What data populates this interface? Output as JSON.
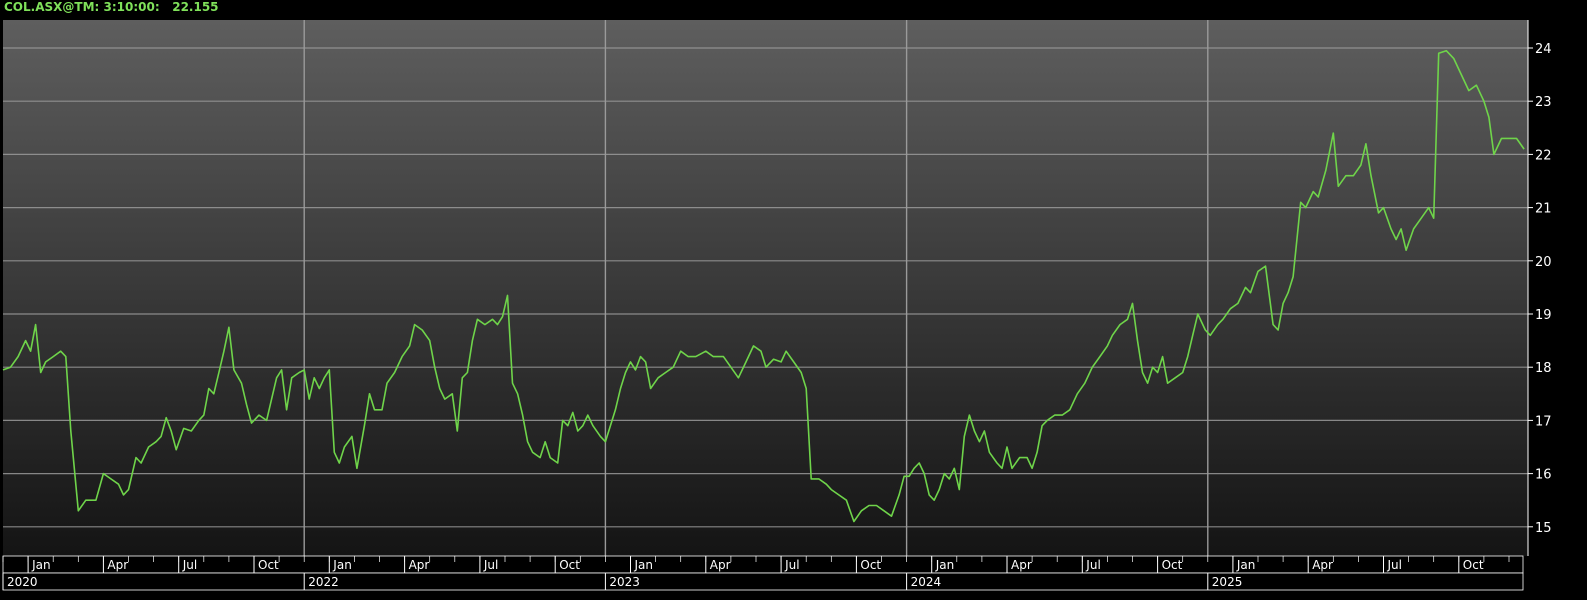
{
  "header": {
    "symbol": "COL.ASX@TM",
    "time": "3:10:00:",
    "last_price": "22.155"
  },
  "colors": {
    "line": "#6fd44a",
    "header_text": "#7fe05a",
    "grid": "#9a9a9a",
    "axis_text": "#ffffff",
    "background_top": "#5e5e5e",
    "background_bottom": "#141414"
  },
  "chart_data": {
    "type": "line",
    "title": "",
    "xlabel": "",
    "ylabel": "",
    "ylim": [
      14.6,
      24.6
    ],
    "yticks": [
      15,
      16,
      17,
      18,
      19,
      20,
      21,
      22,
      23,
      24
    ],
    "grid": true,
    "legend": "none",
    "month_labels": [
      {
        "m": 1,
        "label": "Jan"
      },
      {
        "m": 4,
        "label": "Apr"
      },
      {
        "m": 7,
        "label": "Jul"
      },
      {
        "m": 10,
        "label": "Oct"
      },
      {
        "m": 13,
        "label": "Jan"
      },
      {
        "m": 16,
        "label": "Apr"
      },
      {
        "m": 19,
        "label": "Jul"
      },
      {
        "m": 22,
        "label": "Oct"
      },
      {
        "m": 25,
        "label": "Jan"
      },
      {
        "m": 28,
        "label": "Apr"
      },
      {
        "m": 31,
        "label": "Jul"
      },
      {
        "m": 34,
        "label": "Oct"
      },
      {
        "m": 37,
        "label": "Jan"
      },
      {
        "m": 40,
        "label": "Apr"
      },
      {
        "m": 43,
        "label": "Jul"
      },
      {
        "m": 46,
        "label": "Oct"
      },
      {
        "m": 49,
        "label": "Jan"
      },
      {
        "m": 52,
        "label": "Apr"
      },
      {
        "m": 55,
        "label": "Jul"
      },
      {
        "m": 58,
        "label": "Oct"
      }
    ],
    "year_labels": [
      {
        "m": 0,
        "label": "2020"
      },
      {
        "m": 12,
        "label": "2022"
      },
      {
        "m": 24,
        "label": "2023"
      },
      {
        "m": 36,
        "label": "2024"
      },
      {
        "m": 48,
        "label": "2025"
      }
    ],
    "series": [
      {
        "values": [
          [
            0,
            17.95
          ],
          [
            0.3,
            18.0
          ],
          [
            0.6,
            18.2
          ],
          [
            0.9,
            18.5
          ],
          [
            1.1,
            18.3
          ],
          [
            1.3,
            18.8
          ],
          [
            1.5,
            17.9
          ],
          [
            1.7,
            18.1
          ],
          [
            2.0,
            18.2
          ],
          [
            2.3,
            18.3
          ],
          [
            2.5,
            18.2
          ],
          [
            2.7,
            16.8
          ],
          [
            3.0,
            15.3
          ],
          [
            3.3,
            15.5
          ],
          [
            3.7,
            15.5
          ],
          [
            4.0,
            16.0
          ],
          [
            4.3,
            15.9
          ],
          [
            4.6,
            15.8
          ],
          [
            4.8,
            15.6
          ],
          [
            5.0,
            15.7
          ],
          [
            5.3,
            16.3
          ],
          [
            5.5,
            16.2
          ],
          [
            5.8,
            16.5
          ],
          [
            6.1,
            16.6
          ],
          [
            6.3,
            16.7
          ],
          [
            6.5,
            17.05
          ],
          [
            6.7,
            16.8
          ],
          [
            6.9,
            16.45
          ],
          [
            7.2,
            16.85
          ],
          [
            7.5,
            16.8
          ],
          [
            7.8,
            17.0
          ],
          [
            8.0,
            17.1
          ],
          [
            8.2,
            17.6
          ],
          [
            8.4,
            17.5
          ],
          [
            8.6,
            17.9
          ],
          [
            8.8,
            18.3
          ],
          [
            9.0,
            18.75
          ],
          [
            9.2,
            17.95
          ],
          [
            9.5,
            17.7
          ],
          [
            9.7,
            17.3
          ],
          [
            9.9,
            16.95
          ],
          [
            10.2,
            17.1
          ],
          [
            10.5,
            17.0
          ],
          [
            10.7,
            17.4
          ],
          [
            10.9,
            17.8
          ],
          [
            11.1,
            17.95
          ],
          [
            11.3,
            17.2
          ],
          [
            11.5,
            17.8
          ],
          [
            11.8,
            17.9
          ],
          [
            12.0,
            17.95
          ],
          [
            12.2,
            17.4
          ],
          [
            12.4,
            17.8
          ],
          [
            12.6,
            17.6
          ],
          [
            12.8,
            17.8
          ],
          [
            13.0,
            17.95
          ],
          [
            13.2,
            16.4
          ],
          [
            13.4,
            16.2
          ],
          [
            13.6,
            16.5
          ],
          [
            13.9,
            16.7
          ],
          [
            14.1,
            16.1
          ],
          [
            14.4,
            16.9
          ],
          [
            14.6,
            17.5
          ],
          [
            14.8,
            17.2
          ],
          [
            15.1,
            17.2
          ],
          [
            15.3,
            17.7
          ],
          [
            15.6,
            17.9
          ],
          [
            15.9,
            18.2
          ],
          [
            16.2,
            18.4
          ],
          [
            16.4,
            18.8
          ],
          [
            16.7,
            18.7
          ],
          [
            17.0,
            18.5
          ],
          [
            17.2,
            18.0
          ],
          [
            17.4,
            17.6
          ],
          [
            17.6,
            17.4
          ],
          [
            17.9,
            17.5
          ],
          [
            18.1,
            16.8
          ],
          [
            18.3,
            17.8
          ],
          [
            18.5,
            17.9
          ],
          [
            18.7,
            18.5
          ],
          [
            18.9,
            18.9
          ],
          [
            19.2,
            18.8
          ],
          [
            19.5,
            18.9
          ],
          [
            19.7,
            18.8
          ],
          [
            19.9,
            18.95
          ],
          [
            20.1,
            19.35
          ],
          [
            20.3,
            17.7
          ],
          [
            20.5,
            17.5
          ],
          [
            20.7,
            17.1
          ],
          [
            20.9,
            16.6
          ],
          [
            21.1,
            16.4
          ],
          [
            21.4,
            16.3
          ],
          [
            21.6,
            16.6
          ],
          [
            21.8,
            16.3
          ],
          [
            22.1,
            16.2
          ],
          [
            22.3,
            17.0
          ],
          [
            22.5,
            16.9
          ],
          [
            22.7,
            17.15
          ],
          [
            22.9,
            16.8
          ],
          [
            23.1,
            16.9
          ],
          [
            23.3,
            17.1
          ],
          [
            23.5,
            16.9
          ],
          [
            23.8,
            16.7
          ],
          [
            24.0,
            16.6
          ],
          [
            24.2,
            16.9
          ],
          [
            24.4,
            17.2
          ],
          [
            24.6,
            17.6
          ],
          [
            24.8,
            17.9
          ],
          [
            25.0,
            18.1
          ],
          [
            25.2,
            17.95
          ],
          [
            25.4,
            18.2
          ],
          [
            25.6,
            18.1
          ],
          [
            25.8,
            17.6
          ],
          [
            26.1,
            17.8
          ],
          [
            26.4,
            17.9
          ],
          [
            26.7,
            18.0
          ],
          [
            27.0,
            18.3
          ],
          [
            27.3,
            18.2
          ],
          [
            27.6,
            18.2
          ],
          [
            28.0,
            18.3
          ],
          [
            28.3,
            18.2
          ],
          [
            28.7,
            18.2
          ],
          [
            29.0,
            18.0
          ],
          [
            29.3,
            17.8
          ],
          [
            29.6,
            18.1
          ],
          [
            29.9,
            18.4
          ],
          [
            30.2,
            18.3
          ],
          [
            30.4,
            18.0
          ],
          [
            30.7,
            18.15
          ],
          [
            31.0,
            18.1
          ],
          [
            31.2,
            18.3
          ],
          [
            31.5,
            18.1
          ],
          [
            31.8,
            17.9
          ],
          [
            32.0,
            17.6
          ],
          [
            32.2,
            15.9
          ],
          [
            32.5,
            15.9
          ],
          [
            32.8,
            15.8
          ],
          [
            33.0,
            15.7
          ],
          [
            33.3,
            15.6
          ],
          [
            33.6,
            15.5
          ],
          [
            33.9,
            15.1
          ],
          [
            34.2,
            15.3
          ],
          [
            34.5,
            15.4
          ],
          [
            34.8,
            15.4
          ],
          [
            35.1,
            15.3
          ],
          [
            35.4,
            15.2
          ],
          [
            35.7,
            15.6
          ],
          [
            35.9,
            15.95
          ],
          [
            36.1,
            15.95
          ],
          [
            36.3,
            16.1
          ],
          [
            36.5,
            16.2
          ],
          [
            36.7,
            16.0
          ],
          [
            36.9,
            15.6
          ],
          [
            37.1,
            15.5
          ],
          [
            37.3,
            15.7
          ],
          [
            37.5,
            16.0
          ],
          [
            37.7,
            15.9
          ],
          [
            37.9,
            16.1
          ],
          [
            38.1,
            15.7
          ],
          [
            38.3,
            16.7
          ],
          [
            38.5,
            17.1
          ],
          [
            38.7,
            16.8
          ],
          [
            38.9,
            16.6
          ],
          [
            39.1,
            16.8
          ],
          [
            39.3,
            16.4
          ],
          [
            39.6,
            16.2
          ],
          [
            39.8,
            16.1
          ],
          [
            40.0,
            16.5
          ],
          [
            40.2,
            16.1
          ],
          [
            40.5,
            16.3
          ],
          [
            40.8,
            16.3
          ],
          [
            41.0,
            16.1
          ],
          [
            41.2,
            16.4
          ],
          [
            41.4,
            16.9
          ],
          [
            41.6,
            17.0
          ],
          [
            41.9,
            17.1
          ],
          [
            42.2,
            17.1
          ],
          [
            42.5,
            17.2
          ],
          [
            42.8,
            17.5
          ],
          [
            43.1,
            17.7
          ],
          [
            43.4,
            18.0
          ],
          [
            43.7,
            18.2
          ],
          [
            44.0,
            18.4
          ],
          [
            44.2,
            18.6
          ],
          [
            44.5,
            18.8
          ],
          [
            44.8,
            18.9
          ],
          [
            45.0,
            19.2
          ],
          [
            45.2,
            18.5
          ],
          [
            45.4,
            17.9
          ],
          [
            45.6,
            17.7
          ],
          [
            45.8,
            18.0
          ],
          [
            46.0,
            17.9
          ],
          [
            46.2,
            18.2
          ],
          [
            46.4,
            17.7
          ],
          [
            46.7,
            17.8
          ],
          [
            47.0,
            17.9
          ],
          [
            47.2,
            18.2
          ],
          [
            47.4,
            18.6
          ],
          [
            47.6,
            19.0
          ],
          [
            47.9,
            18.7
          ],
          [
            48.1,
            18.6
          ],
          [
            48.4,
            18.8
          ],
          [
            48.6,
            18.9
          ],
          [
            48.9,
            19.1
          ],
          [
            49.2,
            19.2
          ],
          [
            49.5,
            19.5
          ],
          [
            49.7,
            19.4
          ],
          [
            50.0,
            19.8
          ],
          [
            50.3,
            19.9
          ],
          [
            50.6,
            18.8
          ],
          [
            50.8,
            18.7
          ],
          [
            51.0,
            19.2
          ],
          [
            51.2,
            19.4
          ],
          [
            51.4,
            19.7
          ],
          [
            51.7,
            21.1
          ],
          [
            51.9,
            21.0
          ],
          [
            52.2,
            21.3
          ],
          [
            52.4,
            21.2
          ],
          [
            52.7,
            21.7
          ],
          [
            53.0,
            22.4
          ],
          [
            53.2,
            21.4
          ],
          [
            53.5,
            21.6
          ],
          [
            53.8,
            21.6
          ],
          [
            54.1,
            21.8
          ],
          [
            54.3,
            22.2
          ],
          [
            54.5,
            21.6
          ],
          [
            54.8,
            20.9
          ],
          [
            55.0,
            21.0
          ],
          [
            55.3,
            20.6
          ],
          [
            55.5,
            20.4
          ],
          [
            55.7,
            20.6
          ],
          [
            55.9,
            20.2
          ],
          [
            56.2,
            20.6
          ],
          [
            56.5,
            20.8
          ],
          [
            56.8,
            21.0
          ],
          [
            57.0,
            20.8
          ],
          [
            57.2,
            23.9
          ],
          [
            57.5,
            23.95
          ],
          [
            57.8,
            23.8
          ],
          [
            58.1,
            23.5
          ],
          [
            58.4,
            23.2
          ],
          [
            58.7,
            23.3
          ],
          [
            59.0,
            23.0
          ],
          [
            59.2,
            22.7
          ],
          [
            59.4,
            22.0
          ],
          [
            59.7,
            22.3
          ],
          [
            60.0,
            22.3
          ],
          [
            60.3,
            22.3
          ],
          [
            60.6,
            22.1
          ]
        ]
      }
    ]
  }
}
